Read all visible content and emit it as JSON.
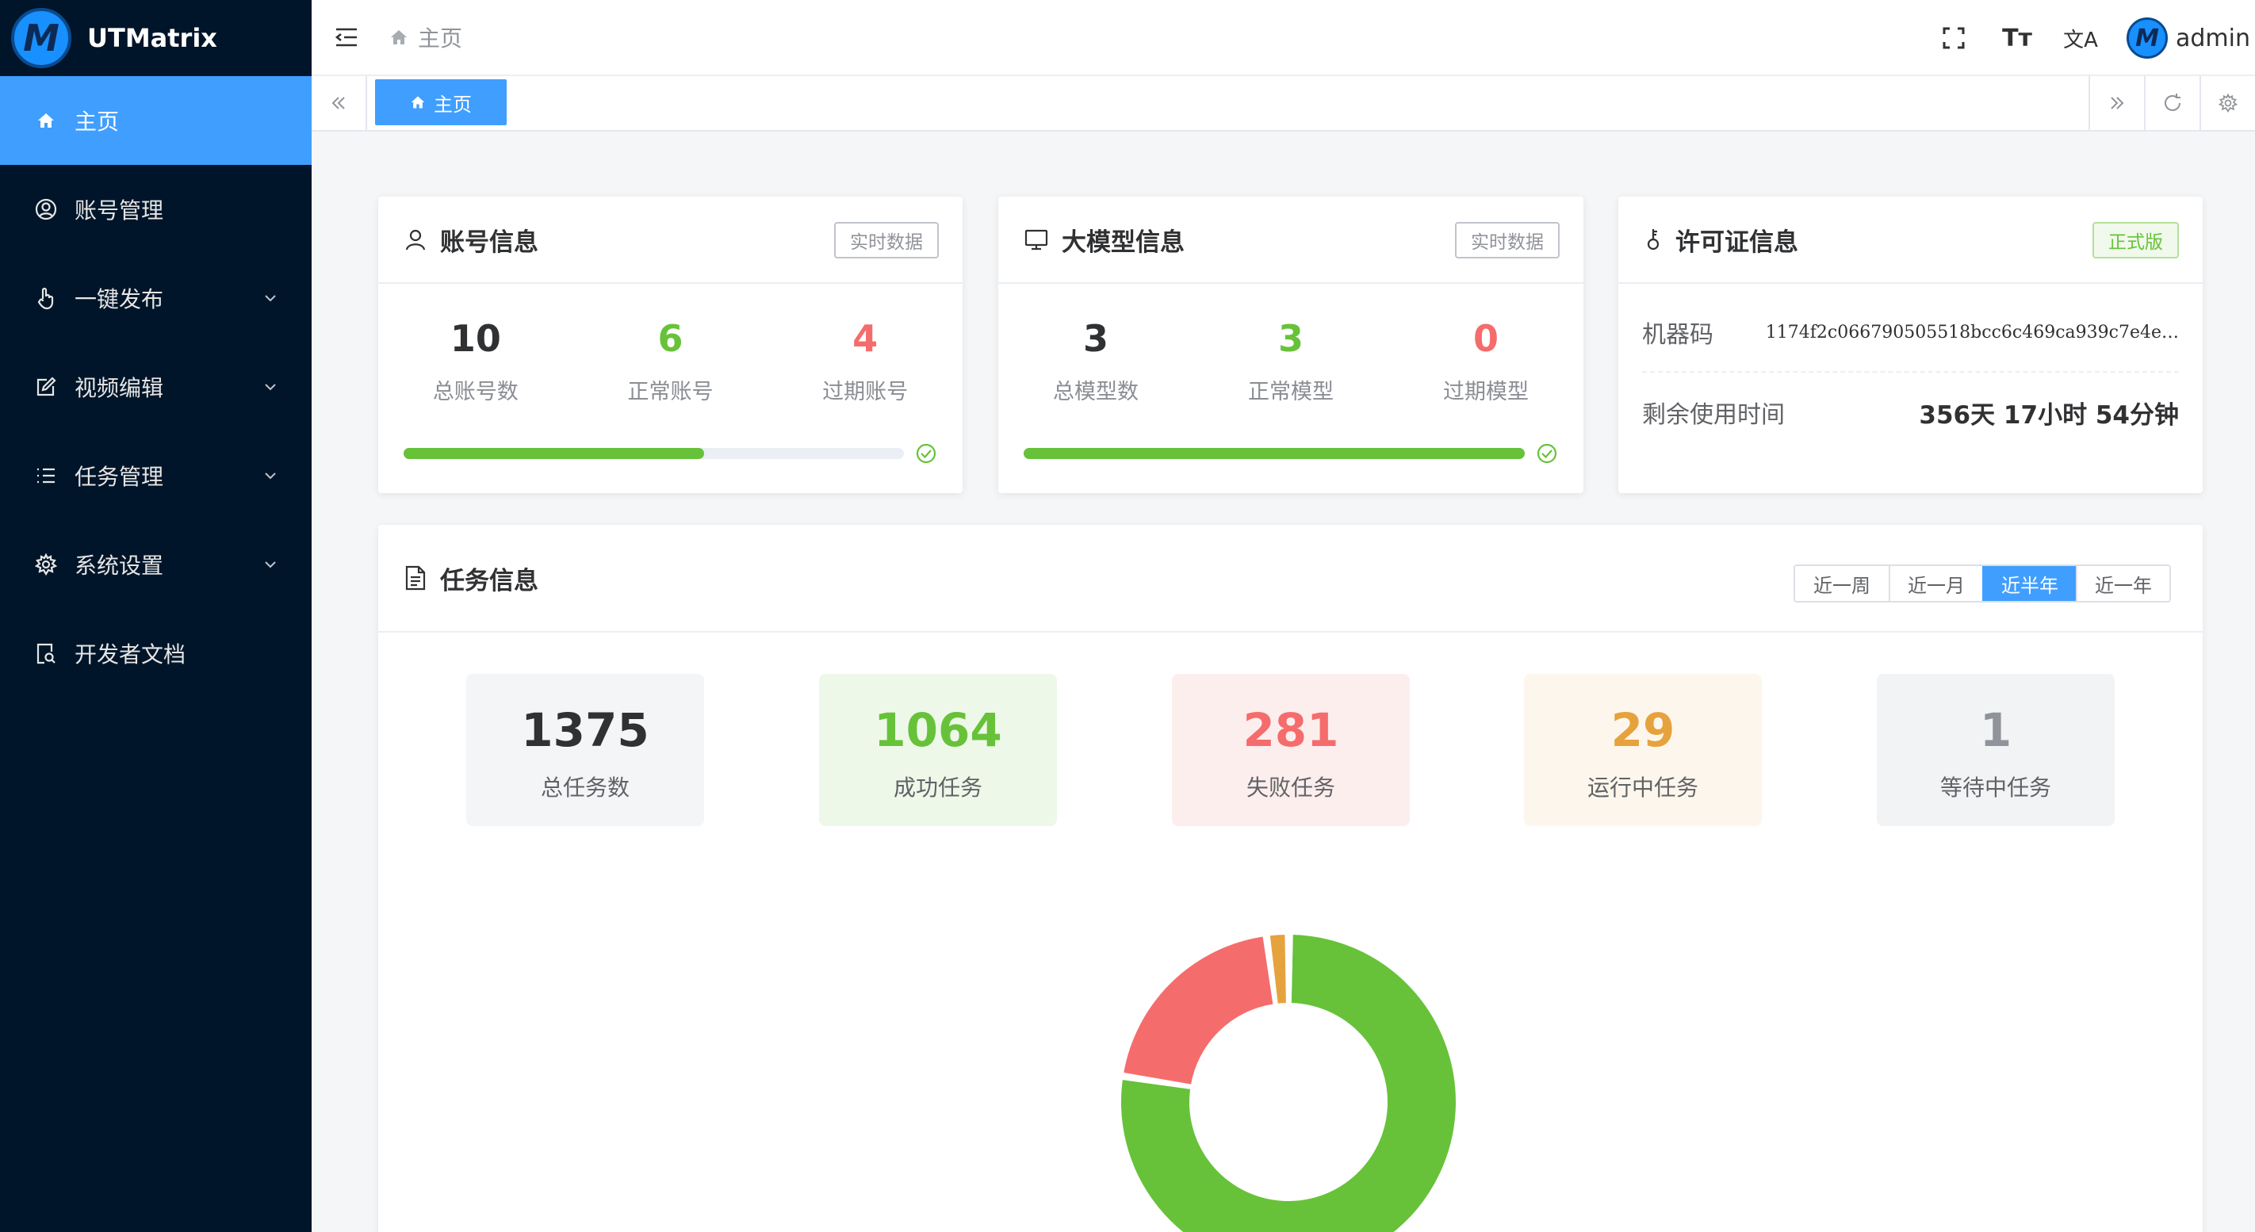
{
  "app": {
    "name": "UTMatrix"
  },
  "sidebar": {
    "items": [
      {
        "label": "主页",
        "active": true,
        "expandable": false
      },
      {
        "label": "账号管理",
        "active": false,
        "expandable": false
      },
      {
        "label": "一键发布",
        "active": false,
        "expandable": true
      },
      {
        "label": "视频编辑",
        "active": false,
        "expandable": true
      },
      {
        "label": "任务管理",
        "active": false,
        "expandable": true
      },
      {
        "label": "系统设置",
        "active": false,
        "expandable": true
      },
      {
        "label": "开发者文档",
        "active": false,
        "expandable": false
      }
    ]
  },
  "header": {
    "breadcrumb": "主页",
    "icons": [
      "fullscreen-icon",
      "font-size-icon",
      "translate-icon"
    ],
    "font_icon_text": "Tт",
    "translate_icon_text": "文A",
    "username": "admin"
  },
  "tabs": {
    "active_label": "主页"
  },
  "account_card": {
    "title": "账号信息",
    "tag": "实时数据",
    "total": "10",
    "total_label": "总账号数",
    "normal": "6",
    "normal_label": "正常账号",
    "expired": "4",
    "expired_label": "过期账号",
    "progress_percent": 60
  },
  "model_card": {
    "title": "大模型信息",
    "tag": "实时数据",
    "total": "3",
    "total_label": "总模型数",
    "normal": "3",
    "normal_label": "正常模型",
    "expired": "0",
    "expired_label": "过期模型",
    "progress_percent": 100
  },
  "license_card": {
    "title": "许可证信息",
    "tag": "正式版",
    "machine_code_label": "机器码",
    "machine_code": "1174f2c066790505518bcc6c469ca939c7e4e…",
    "remaining_label": "剩余使用时间",
    "remaining": "356天 17小时 54分钟"
  },
  "task_card": {
    "title": "任务信息",
    "periods": [
      "近一周",
      "近一月",
      "近半年",
      "近一年"
    ],
    "active_period": "近半年",
    "total": "1375",
    "total_label": "总任务数",
    "success": "1064",
    "success_label": "成功任务",
    "failed": "281",
    "failed_label": "失败任务",
    "running": "29",
    "running_label": "运行中任务",
    "waiting": "1",
    "waiting_label": "等待中任务"
  },
  "colors": {
    "sidebar_bg": "#001529",
    "accent": "#409eff",
    "success": "#67c23a",
    "danger": "#f56c6c",
    "warning": "#e6a23c",
    "info": "#909399"
  },
  "chart_data": {
    "type": "pie",
    "donut": true,
    "series": [
      {
        "label": "成功任务",
        "value": 1064,
        "color": "#67c23a"
      },
      {
        "label": "失败任务",
        "value": 281,
        "color": "#f56c6c"
      },
      {
        "label": "运行中任务",
        "value": 29,
        "color": "#e6a23c"
      },
      {
        "label": "等待中任务",
        "value": 1,
        "color": "#909399"
      }
    ]
  }
}
